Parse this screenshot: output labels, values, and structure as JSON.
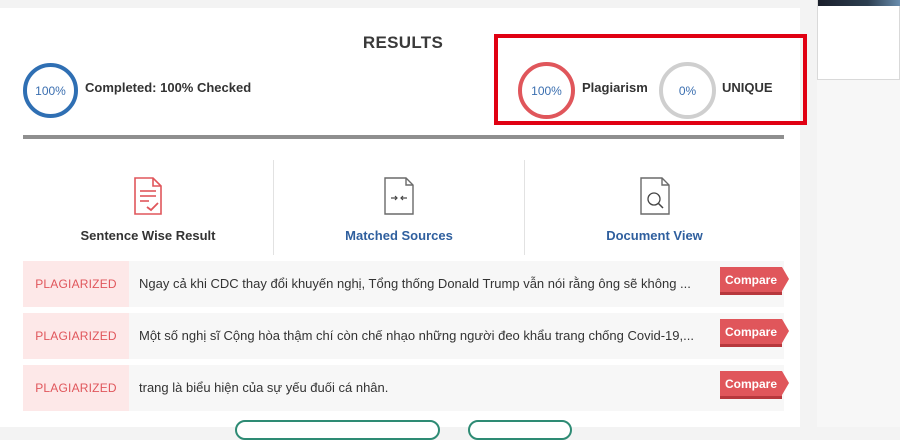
{
  "header": {
    "title": "RESULTS"
  },
  "progress": {
    "ring_value": "100%",
    "label": "Completed: 100% Checked",
    "percent": 100
  },
  "plagiarism": {
    "ring_value": "100%",
    "label": "Plagiarism",
    "percent": 100
  },
  "unique": {
    "ring_value": "0%",
    "label": "UNIQUE",
    "percent": 0
  },
  "tabs": [
    {
      "label": "Sentence Wise Result",
      "icon": "document-check-icon",
      "color": "#333333"
    },
    {
      "label": "Matched Sources",
      "icon": "compare-arrows-icon",
      "color": "#2f5f9e"
    },
    {
      "label": "Document View",
      "icon": "document-search-icon",
      "color": "#2f5f9e"
    }
  ],
  "results": [
    {
      "status": "PLAGIARIZED",
      "text": "Ngay cả khi CDC thay đổi khuyến nghị, Tổng thống Donald Trump vẫn nói rằng ông sẽ không ...",
      "action": "Compare"
    },
    {
      "status": "PLAGIARIZED",
      "text": "Một số nghị sĩ Cộng hòa thậm chí còn chế nhạo những người đeo khẩu trang chống Covid-19,...",
      "action": "Compare"
    },
    {
      "status": "PLAGIARIZED",
      "text": "trang là biểu hiện của sự yếu đuối cá nhân.",
      "action": "Compare"
    }
  ],
  "colors": {
    "accent_red": "#e0565b",
    "accent_blue": "#2f6fb3",
    "highlight": "#e00012"
  }
}
